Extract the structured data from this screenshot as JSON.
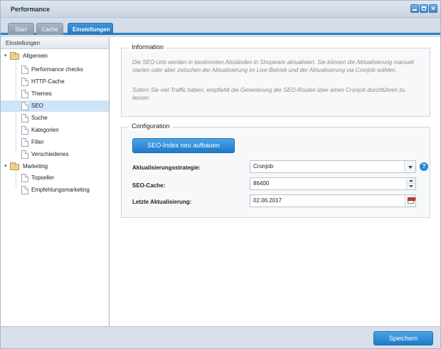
{
  "window": {
    "title": "Performance",
    "controls": [
      "minimize-icon",
      "maximize-icon",
      "close-icon"
    ],
    "close_glyph": "×"
  },
  "tabs": [
    {
      "label": "Start"
    },
    {
      "label": "Cache"
    },
    {
      "label": "Einstellungen",
      "active": true
    }
  ],
  "sidebar": {
    "header": "Einstellungen",
    "groups": [
      {
        "label": "Allgemein",
        "expanded": true,
        "icon": "folder-icon",
        "items": [
          {
            "label": "Performance checks"
          },
          {
            "label": "HTTP-Cache"
          },
          {
            "label": "Themes"
          },
          {
            "label": "SEO",
            "selected": true
          },
          {
            "label": "Suche"
          },
          {
            "label": "Kategorien"
          },
          {
            "label": "Filter"
          },
          {
            "label": "Verschiedenes"
          }
        ]
      },
      {
        "label": "Marketing",
        "expanded": true,
        "icon": "folder-icon",
        "items": [
          {
            "label": "Topseller"
          },
          {
            "label": "Empfehlungsmarketing"
          }
        ]
      }
    ],
    "expanded_arrow": "▾"
  },
  "information": {
    "legend": "Information",
    "paragraph1": "Die SEO-Urls werden in bestimmten Abständen in Shopware aktualisiert. Sie können die Aktualisierung manuell starten oder aber zwischen der Aktualisierung im Live-Betrieb und der Aktualisierung via Cronjob wählen.",
    "paragraph2": "Sofern Sie viel Traffic haben, empfiehlt die Generierung der SEO-Routen über einen Cronjob durchführen zu lassen."
  },
  "configuration": {
    "legend": "Configuration",
    "rebuild_button": "SEO-Index neu aufbauen",
    "strategy_label": "Aktualisierungsstrategie:",
    "strategy_value": "Cronjob",
    "cache_label": "SEO-Cache:",
    "cache_value": "86400",
    "updated_label": "Letzte Aktualisierung:",
    "updated_value": "02.06.2017",
    "help_glyph": "?"
  },
  "footer": {
    "save_label": "Speichern"
  },
  "colors": {
    "accent": "#2d7fc6",
    "selected_row": "#cfe3f6",
    "frame": "#d8e0ea"
  }
}
